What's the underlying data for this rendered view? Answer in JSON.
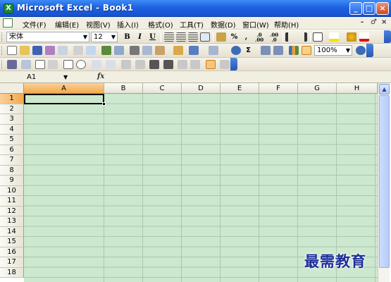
{
  "window": {
    "title": "Microsoft Excel - Book1",
    "app_icon": "X",
    "minimize": "_",
    "maximize": "□",
    "close": "×"
  },
  "menubar": {
    "items": [
      "文件(F)",
      "编辑(E)",
      "视图(V)",
      "插入(I)",
      "格式(O)",
      "工具(T)",
      "数据(D)",
      "窗口(W)",
      "帮助(H)"
    ],
    "controls": [
      "-",
      "♂",
      "×"
    ]
  },
  "format_toolbar": {
    "font_name": "宋体",
    "font_size": "12",
    "bold": "B",
    "italic": "I",
    "underline": "U",
    "percent": "%",
    "comma": ",",
    "inc_decimal": ".0 .00",
    "dec_decimal": ".00 .0"
  },
  "standard_toolbar": {
    "zoom": "100%",
    "sigma": "Σ"
  },
  "formula_bar": {
    "name_box": "A1",
    "fx": "fx",
    "value": ""
  },
  "grid": {
    "columns": [
      "A",
      "B",
      "C",
      "D",
      "E",
      "F",
      "G",
      "H"
    ],
    "rows": [
      "1",
      "2",
      "3",
      "4",
      "5",
      "6",
      "7",
      "8",
      "9",
      "10",
      "11",
      "12",
      "13",
      "14",
      "15",
      "16",
      "17",
      "18"
    ],
    "selected_column": "A",
    "selected_row": "1",
    "active_cell": "A1",
    "cell_color": "#cce8cf"
  },
  "colors": {
    "title_bar": "#1f62de",
    "menu_bg": "#f1efe2",
    "selection_header": "#f3a94b",
    "watermark": "#1f2e9a"
  },
  "watermark": "最需教育"
}
